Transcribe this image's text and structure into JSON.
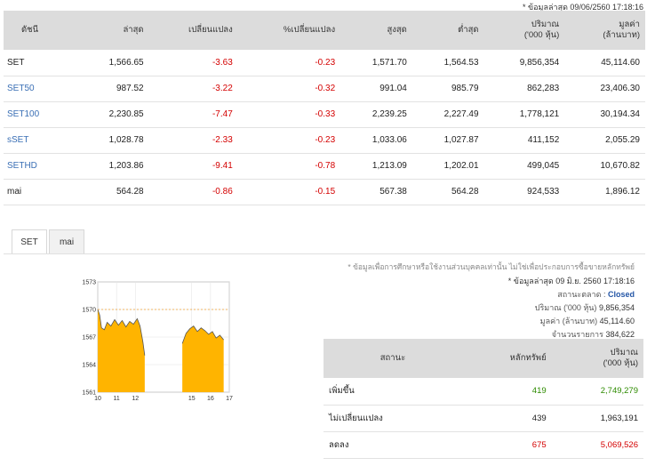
{
  "updated_top": "* ข้อมูลล่าสุด 09/06/2560 17:18:16",
  "index_table": {
    "headers": [
      "ดัชนี",
      "ล่าสุด",
      "เปลี่ยนแปลง",
      "%เปลี่ยนแปลง",
      "สูงสุด",
      "ต่ำสุด",
      "ปริมาณ\n('000 หุ้น)",
      "มูลค่า\n(ล้านบาท)"
    ],
    "rows": [
      [
        "SET",
        "1,566.65",
        "-3.63",
        "-0.23",
        "1,571.70",
        "1,564.53",
        "9,856,354",
        "45,114.60"
      ],
      [
        "SET50",
        "987.52",
        "-3.22",
        "-0.32",
        "991.04",
        "985.79",
        "862,283",
        "23,406.30"
      ],
      [
        "SET100",
        "2,230.85",
        "-7.47",
        "-0.33",
        "2,239.25",
        "2,227.49",
        "1,778,121",
        "30,194.34"
      ],
      [
        "sSET",
        "1,028.78",
        "-2.33",
        "-0.23",
        "1,033.06",
        "1,027.87",
        "411,152",
        "2,055.29"
      ],
      [
        "SETHD",
        "1,203.86",
        "-9.41",
        "-0.78",
        "1,213.09",
        "1,202.01",
        "499,045",
        "10,670.82"
      ],
      [
        "mai",
        "564.28",
        "-0.86",
        "-0.15",
        "567.38",
        "564.28",
        "924,533",
        "1,896.12"
      ]
    ]
  },
  "tabs": [
    "SET",
    "mai"
  ],
  "chart_data": {
    "type": "area",
    "x_ticks": [
      "10",
      "11",
      "12",
      "15",
      "16",
      "17"
    ],
    "y_ticks": [
      "1573",
      "1570",
      "1567",
      "1564",
      "1561"
    ],
    "ylim": [
      1561,
      1573
    ],
    "reference_line": 1570,
    "colors": {
      "fill": "#ffb400",
      "line": "#555555",
      "reference": "#f0a030"
    },
    "segments": [
      {
        "x": [
          10,
          10.1,
          10.2,
          10.35,
          10.5,
          10.7,
          10.9,
          11.1,
          11.3,
          11.5,
          11.7,
          11.9,
          12.1,
          12.25,
          12.4,
          12.5
        ],
        "y": [
          1570.0,
          1569.4,
          1568.0,
          1567.8,
          1568.6,
          1568.2,
          1568.9,
          1568.3,
          1568.8,
          1568.1,
          1568.7,
          1568.4,
          1569.0,
          1568.2,
          1566.5,
          1565.0
        ]
      },
      {
        "x": [
          14.5,
          14.7,
          14.9,
          15.1,
          15.3,
          15.5,
          15.7,
          15.9,
          16.1,
          16.3,
          16.5,
          16.7
        ],
        "y": [
          1566.3,
          1567.4,
          1567.9,
          1568.2,
          1567.6,
          1568.0,
          1567.7,
          1567.3,
          1567.6,
          1566.9,
          1567.2,
          1566.7
        ]
      }
    ]
  },
  "info": {
    "disclaimer": "* ข้อมูลเพื่อการศึกษาหรือใช้งานส่วนบุคคลเท่านั้น ไม่ใช่เพื่อประกอบการซื้อขายหลักทรัพย์",
    "updated": "* ข้อมูลล่าสุด 09 มิ.ย. 2560 17:18:16",
    "status_label": "สถานะตลาด :",
    "status_value": "Closed",
    "volume_label": "ปริมาณ ('000 หุ้น)",
    "volume_value": "9,856,354",
    "value_label": "มูลค่า (ล้านบาท)",
    "value_value": "45,114.60",
    "deals_label": "จำนวนรายการ",
    "deals_value": "384,622"
  },
  "summary": {
    "headers": [
      "สถานะ",
      "หลักทรัพย์",
      "ปริมาณ\n('000 หุ้น)"
    ],
    "rows": [
      [
        "เพิ่มขึ้น",
        "419",
        "2,749,279"
      ],
      [
        "ไม่เปลี่ยนแปลง",
        "439",
        "1,963,191"
      ],
      [
        "ลดลง",
        "675",
        "5,069,526"
      ]
    ]
  }
}
